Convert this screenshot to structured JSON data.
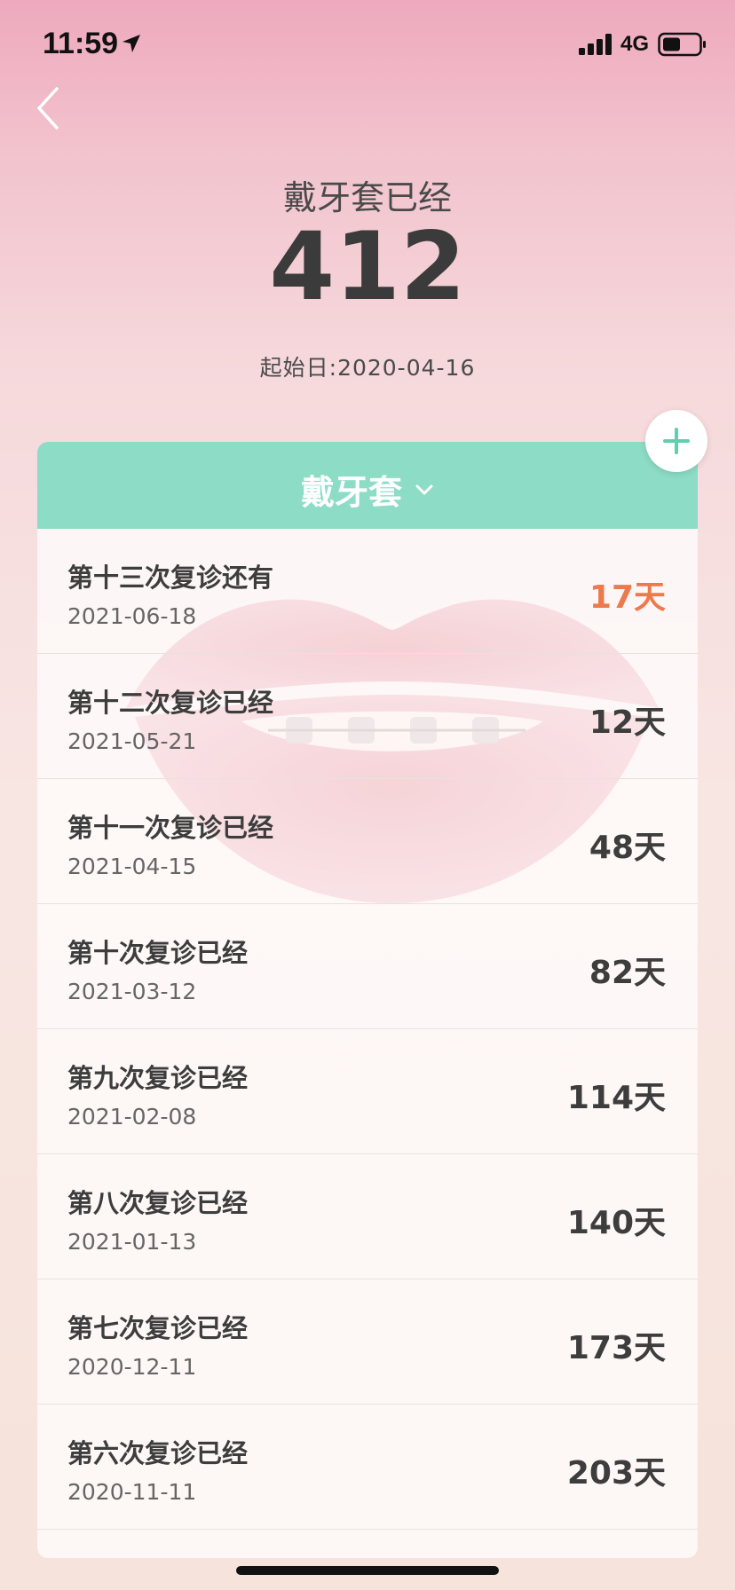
{
  "status_bar": {
    "time": "11:59",
    "network": "4G",
    "icons": [
      "location-arrow-icon",
      "signal-bars-icon",
      "battery-icon"
    ]
  },
  "nav": {
    "back_icon": "chevron-left-icon"
  },
  "header": {
    "label": "戴牙套已经",
    "count": "412",
    "start_date": "起始日:2020-04-16"
  },
  "card": {
    "title": "戴牙套",
    "title_icon": "chevron-down-icon",
    "accent_color": "#8ddcc6",
    "highlight_color": "#ed7a4c",
    "add_icon": "plus-icon",
    "items": [
      {
        "title": "第十三次复诊还有",
        "date": "2021-06-18",
        "days": "17天",
        "upcoming": true
      },
      {
        "title": "第十二次复诊已经",
        "date": "2021-05-21",
        "days": "12天",
        "upcoming": false
      },
      {
        "title": "第十一次复诊已经",
        "date": "2021-04-15",
        "days": "48天",
        "upcoming": false
      },
      {
        "title": "第十次复诊已经",
        "date": "2021-03-12",
        "days": "82天",
        "upcoming": false
      },
      {
        "title": "第九次复诊已经",
        "date": "2021-02-08",
        "days": "114天",
        "upcoming": false
      },
      {
        "title": "第八次复诊已经",
        "date": "2021-01-13",
        "days": "140天",
        "upcoming": false
      },
      {
        "title": "第七次复诊已经",
        "date": "2020-12-11",
        "days": "173天",
        "upcoming": false
      },
      {
        "title": "第六次复诊已经",
        "date": "2020-11-11",
        "days": "203天",
        "upcoming": false
      }
    ]
  }
}
